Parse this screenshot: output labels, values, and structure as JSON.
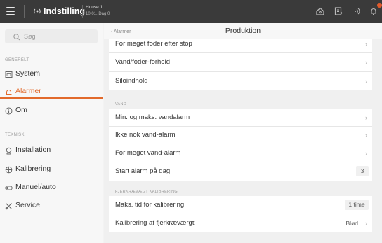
{
  "topbar": {
    "title": "Indstilling",
    "house": "House 1",
    "subtitle": "10:01, Dag 0",
    "icons": [
      "menu-icon",
      "app-logo-icon",
      "home-icon",
      "clipboard-icon",
      "signal-icon",
      "alarm-bell-icon"
    ],
    "accent": "#e26a2c"
  },
  "sidebar": {
    "search_placeholder": "Søg",
    "sections": [
      {
        "header": "GENERELT",
        "items": [
          {
            "label": "System",
            "icon": "system-icon",
            "active": false
          },
          {
            "label": "Alarmer",
            "icon": "alarm-icon",
            "active": true
          },
          {
            "label": "Om",
            "icon": "info-icon",
            "active": false
          }
        ]
      },
      {
        "header": "TEKNISK",
        "items": [
          {
            "label": "Installation",
            "icon": "installation-icon",
            "active": false
          },
          {
            "label": "Kalibrering",
            "icon": "calibration-icon",
            "active": false
          },
          {
            "label": "Manuel/auto",
            "icon": "toggle-icon",
            "active": false
          },
          {
            "label": "Service",
            "icon": "service-icon",
            "active": false
          }
        ]
      }
    ]
  },
  "main": {
    "back_label": "Alarmer",
    "title": "Produktion",
    "rows_top": [
      {
        "label": "For meget foder efter stop"
      },
      {
        "label": "Vand/foder-forhold"
      },
      {
        "label": "Siloindhold"
      }
    ],
    "group_vand": "VAND",
    "rows_vand": [
      {
        "label": "Min. og maks. vandalarm"
      },
      {
        "label": "Ikke nok vand-alarm"
      },
      {
        "label": "For meget vand-alarm"
      },
      {
        "label": "Start alarm på dag",
        "value": "3"
      }
    ],
    "group_kalib": "FJERKRÆVÆGT KALIBRERING",
    "rows_kalib": [
      {
        "label": "Maks. tid for kalibrering",
        "value": "1 time"
      },
      {
        "label": "Kalibrering af fjerkræværgt",
        "value": "Blød"
      }
    ]
  }
}
